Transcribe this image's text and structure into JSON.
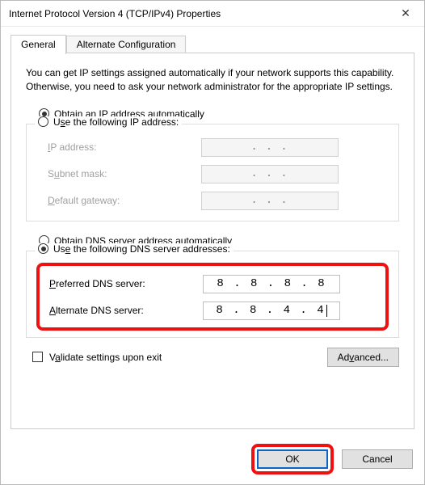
{
  "window": {
    "title": "Internet Protocol Version 4 (TCP/IPv4) Properties"
  },
  "tabs": {
    "general": "General",
    "alternate": "Alternate Configuration"
  },
  "description": "You can get IP settings assigned automatically if your network supports this capability. Otherwise, you need to ask your network administrator for the appropriate IP settings.",
  "ip": {
    "auto_label_pre": "O",
    "auto_label_post": "btain an IP address automatically",
    "manual_label_pre": "U",
    "manual_label_post": "se the following IP address:",
    "auto_selected": true,
    "fields": {
      "ip_pre": "I",
      "ip_post": "P address:",
      "mask_pre": "S",
      "mask_post": "ubnet mask:",
      "gw_pre": "D",
      "gw_post": "efault gateway:"
    }
  },
  "dns": {
    "auto_label_pre": "O",
    "auto_label_post": "btain DNS server address automatically",
    "manual_label_pre": "Us",
    "manual_label_post": "e the following DNS server addresses:",
    "manual_selected": true,
    "preferred_pre": "P",
    "preferred_post": "referred DNS server:",
    "alternate_pre": "A",
    "alternate_post": "lternate DNS server:",
    "preferred_value": "8 . 8 . 8 . 8",
    "alternate_value": "8 . 8 . 4 . 4"
  },
  "validate_pre": "V",
  "validate_post": "alidate settings upon exit",
  "advanced_label": "Advanced...",
  "buttons": {
    "ok": "OK",
    "cancel": "Cancel"
  }
}
